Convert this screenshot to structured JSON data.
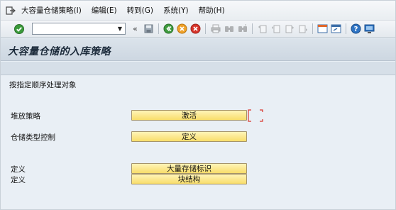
{
  "menubar": {
    "exit_icon": "exit-icon",
    "items": [
      {
        "label": "大容量仓储策略(I)"
      },
      {
        "label": "编辑(E)"
      },
      {
        "label": "转到(G)"
      },
      {
        "label": "系统(Y)"
      },
      {
        "label": "帮助(H)"
      }
    ]
  },
  "toolbar": {
    "command_field_value": "",
    "icons": [
      "enter-icon",
      "save-icon",
      "back-icon",
      "exit-icon",
      "cancel-icon",
      "print-icon",
      "find-icon",
      "find-next-icon",
      "first-page-icon",
      "previous-page-icon",
      "next-page-icon",
      "last-page-icon",
      "create-session-icon",
      "shortcut-icon",
      "help-icon",
      "customize-layout-icon"
    ]
  },
  "title": "大容量仓储的入库策略",
  "content": {
    "instruction": "按指定顺序处理对象",
    "rows": [
      {
        "label": "堆放策略",
        "button": "激活"
      },
      {
        "label": "仓储类型控制",
        "button": "定义"
      },
      {
        "label": "定义",
        "button": "大量存储标识"
      },
      {
        "label": "定义",
        "button": "块结构"
      }
    ]
  },
  "colors": {
    "button_fill": "#f8dd6a",
    "focus_bracket": "#d9342b",
    "background": "#e9eff5"
  }
}
